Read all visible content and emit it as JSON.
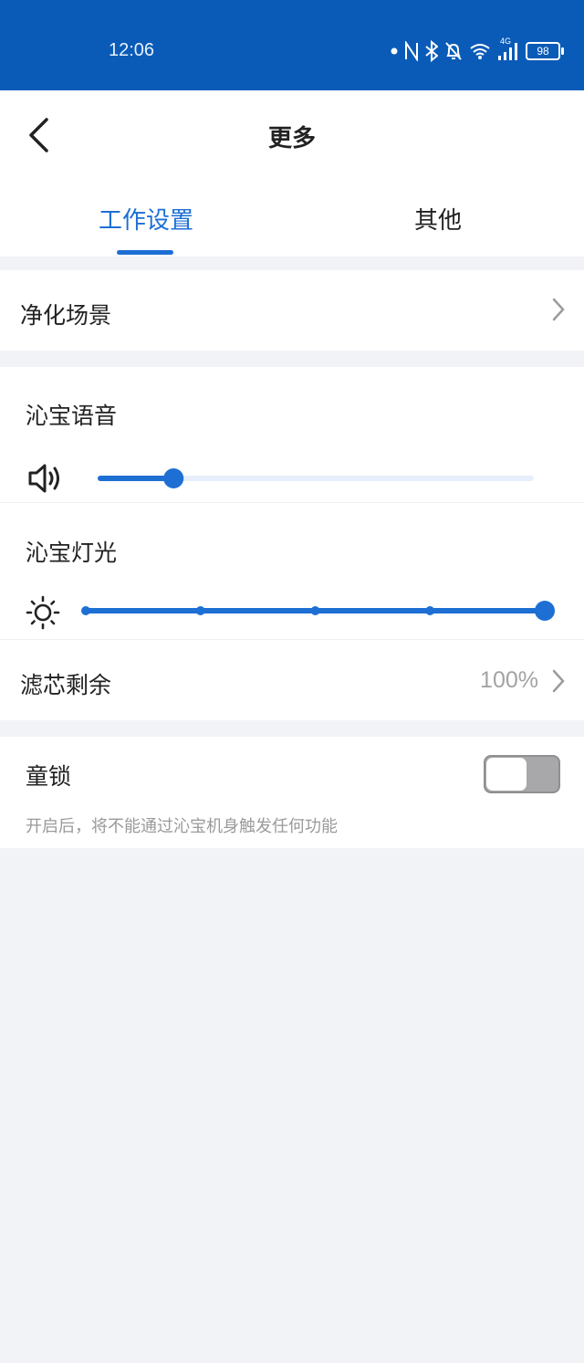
{
  "status_bar": {
    "time": "12:06",
    "network_label": "4G",
    "battery": "98",
    "icons": [
      "dot-icon",
      "nfc-icon",
      "bluetooth-icon",
      "bell-muted-icon",
      "wifi-icon",
      "signal-icon",
      "battery-icon"
    ]
  },
  "header": {
    "title": "更多",
    "back_icon": "chevron-left-icon",
    "tabs": [
      {
        "label": "工作设置",
        "active": true
      },
      {
        "label": "其他",
        "active": false
      }
    ]
  },
  "settings": {
    "scene": {
      "label": "净化场景",
      "chevron": "chevron-right-icon"
    },
    "voice": {
      "label": "沁宝语音",
      "icon": "speaker-icon",
      "level": 0.17
    },
    "light": {
      "label": "沁宝灯光",
      "icon": "sun-icon",
      "level": 1.0,
      "steps": 5
    },
    "filter": {
      "label": "滤芯剩余",
      "value": "100%",
      "chevron": "chevron-right-icon"
    },
    "child_lock": {
      "label": "童锁",
      "enabled": false,
      "hint": "开启后，将不能通过沁宝机身触发任何功能"
    }
  },
  "colors": {
    "status_bar": "#0a5bb7",
    "accent": "#1d6fd4",
    "background": "#f2f3f7",
    "slider_track": "#e6effb"
  }
}
